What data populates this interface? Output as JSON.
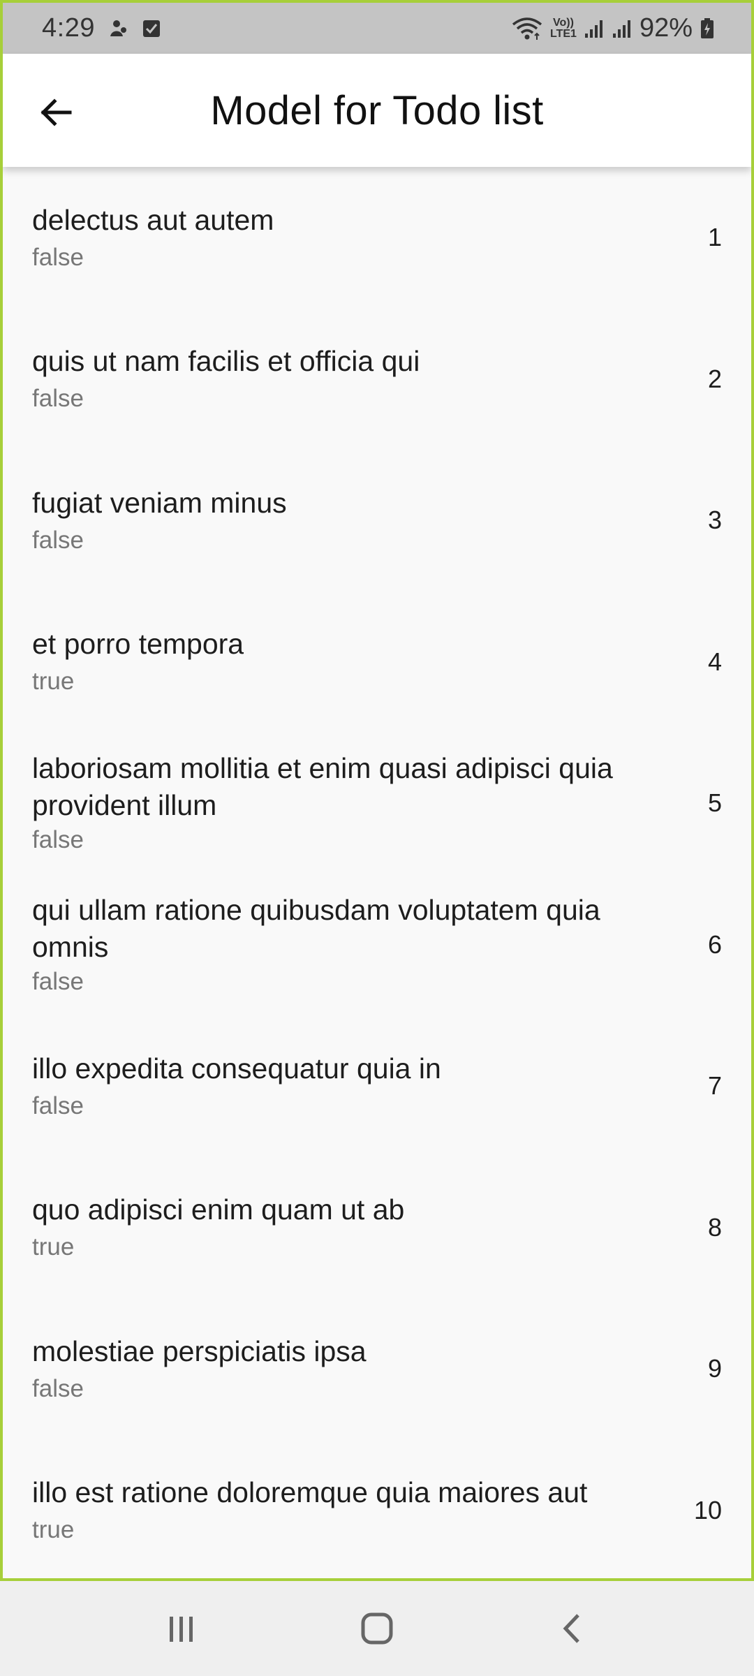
{
  "status_bar": {
    "time": "4:29",
    "battery": "92%",
    "network_label_top": "Vo))",
    "network_label_bottom": "LTE1"
  },
  "app_bar": {
    "title": "Model for Todo list"
  },
  "todos": [
    {
      "title": "delectus aut autem",
      "completed": "false",
      "id": "1"
    },
    {
      "title": "quis ut nam facilis et officia qui",
      "completed": "false",
      "id": "2"
    },
    {
      "title": "fugiat veniam minus",
      "completed": "false",
      "id": "3"
    },
    {
      "title": "et porro tempora",
      "completed": "true",
      "id": "4"
    },
    {
      "title": "laboriosam mollitia et enim quasi adipisci quia provident illum",
      "completed": "false",
      "id": "5"
    },
    {
      "title": "qui ullam ratione quibusdam voluptatem quia omnis",
      "completed": "false",
      "id": "6"
    },
    {
      "title": "illo expedita consequatur quia in",
      "completed": "false",
      "id": "7"
    },
    {
      "title": "quo adipisci enim quam ut ab",
      "completed": "true",
      "id": "8"
    },
    {
      "title": "molestiae perspiciatis ipsa",
      "completed": "false",
      "id": "9"
    },
    {
      "title": "illo est ratione doloremque quia maiores aut",
      "completed": "true",
      "id": "10"
    }
  ],
  "colors": {
    "frame_border": "#a7cf3a",
    "status_bar_bg": "#c4c4c4",
    "app_bar_bg": "#ffffff",
    "list_bg": "#f9f9f9",
    "subtitle_text": "#777777"
  },
  "icons": {
    "back": "arrow-back-icon",
    "recents": "recent-apps-icon",
    "home": "home-icon",
    "nav_back": "chevron-left-icon"
  }
}
